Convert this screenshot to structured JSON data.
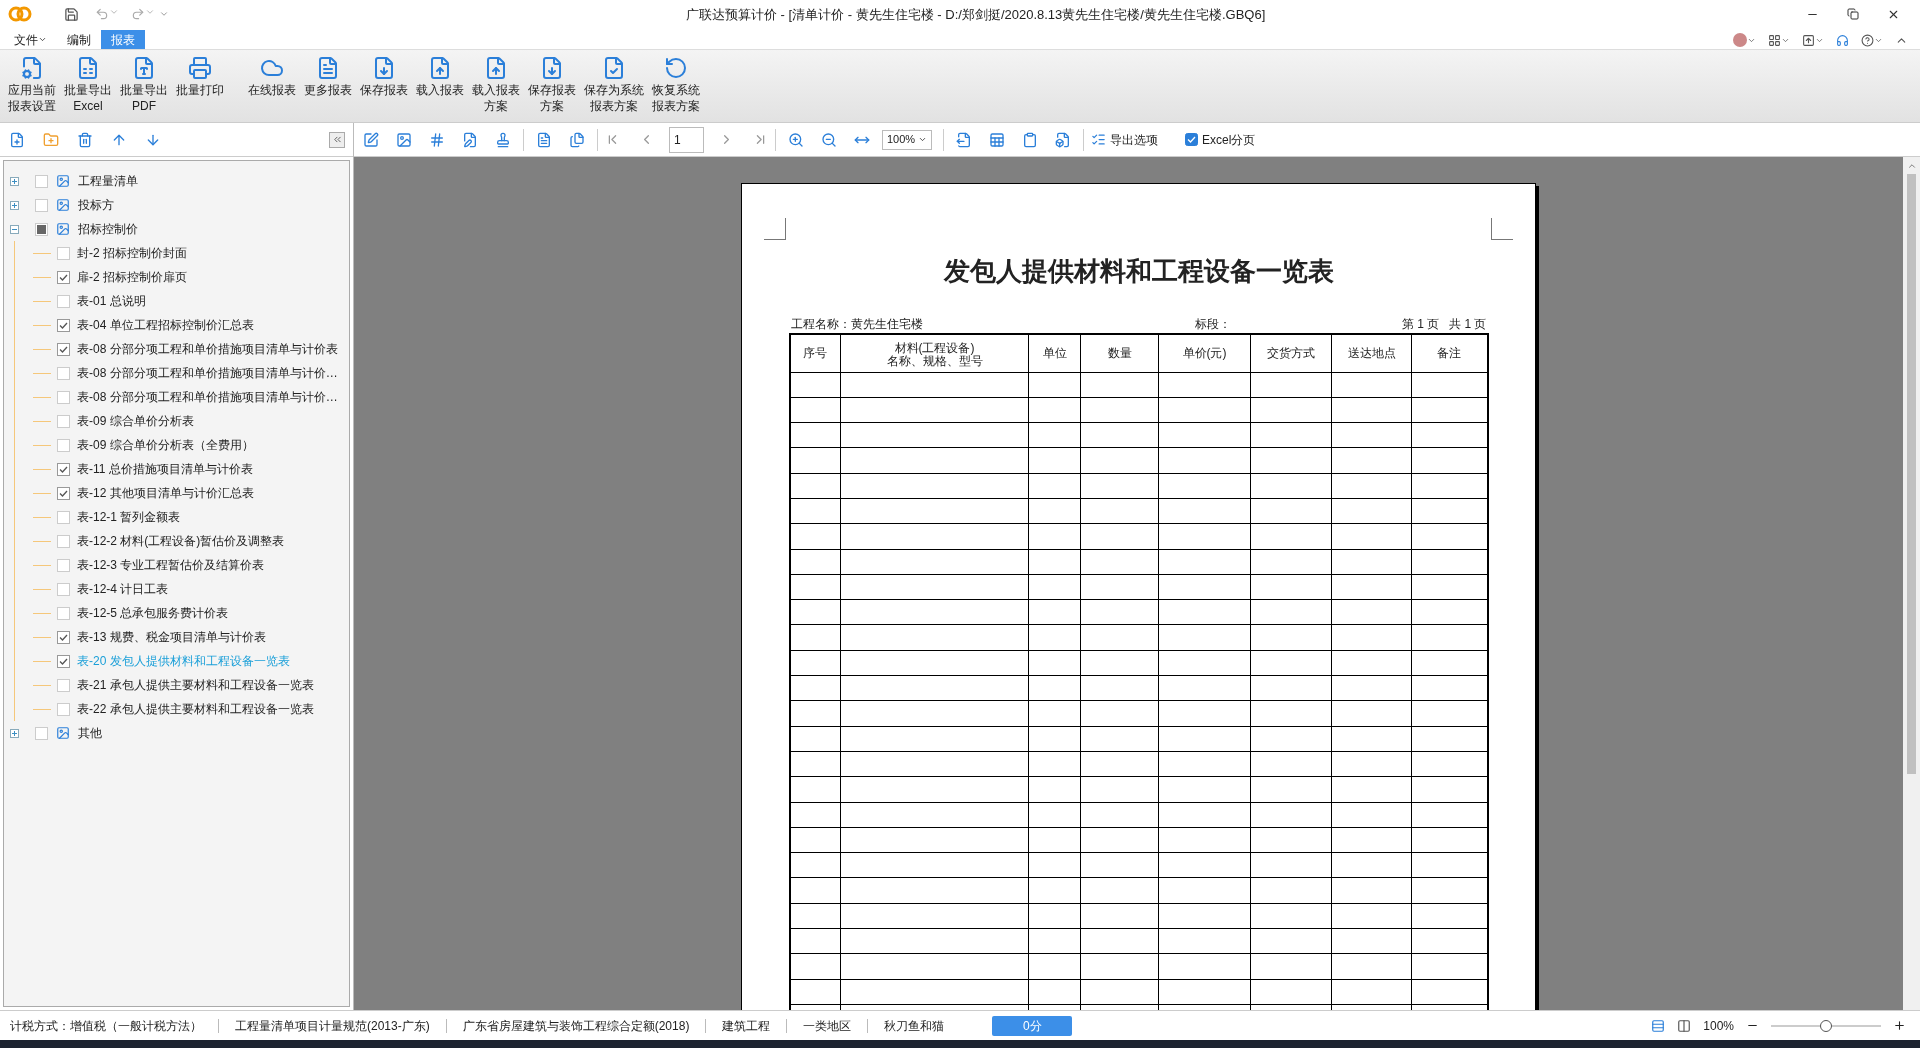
{
  "window": {
    "title": "广联达预算计价 - [清单计价 - 黄先生住宅楼 - D:/郑剑挺/2020.8.13黄先生住宅楼/黄先生住宅楼.GBQ6]"
  },
  "menu_tabs": [
    {
      "label": "文件",
      "kind": "dropdown",
      "selected": false
    },
    {
      "label": "编制",
      "kind": "tab",
      "selected": false
    },
    {
      "label": "报表",
      "kind": "tab",
      "selected": true
    }
  ],
  "ribbon": [
    {
      "lines": [
        "应用当前",
        "报表设置"
      ]
    },
    {
      "lines": [
        "批量导出",
        "Excel"
      ]
    },
    {
      "lines": [
        "批量导出",
        "PDF"
      ]
    },
    {
      "lines": [
        "批量打印"
      ]
    },
    {
      "lines": [
        "在线报表"
      ]
    },
    {
      "lines": [
        "更多报表"
      ]
    },
    {
      "lines": [
        "保存报表"
      ]
    },
    {
      "lines": [
        "载入报表"
      ]
    },
    {
      "lines": [
        "载入报表",
        "方案"
      ]
    },
    {
      "lines": [
        "保存报表",
        "方案"
      ]
    },
    {
      "lines": [
        "保存为系统",
        "报表方案"
      ]
    },
    {
      "lines": [
        "恢复系统",
        "报表方案"
      ]
    }
  ],
  "tree": [
    {
      "label": "工程量清单",
      "checked": false,
      "indeterminate": false,
      "expanded": false
    },
    {
      "label": "投标方",
      "checked": false,
      "indeterminate": false,
      "expanded": false
    },
    {
      "label": "招标控制价",
      "checked": false,
      "indeterminate": true,
      "expanded": true,
      "children": [
        {
          "label": "封-2  招标控制价封面",
          "checked": false,
          "selected": false
        },
        {
          "label": "扉-2  招标控制价扉页",
          "checked": true,
          "selected": false
        },
        {
          "label": "表-01  总说明",
          "checked": false,
          "selected": false
        },
        {
          "label": "表-04  单位工程招标控制价汇总表",
          "checked": true,
          "selected": false
        },
        {
          "label": "表-08  分部分项工程和单价措施项目清单与计价表",
          "checked": true,
          "selected": false
        },
        {
          "label": "表-08  分部分项工程和单价措施项目清单与计价…",
          "checked": false,
          "selected": false
        },
        {
          "label": "表-08  分部分项工程和单价措施项目清单与计价…",
          "checked": false,
          "selected": false
        },
        {
          "label": "表-09  综合单价分析表",
          "checked": false,
          "selected": false
        },
        {
          "label": "表-09  综合单价分析表（全费用）",
          "checked": false,
          "selected": false
        },
        {
          "label": "表-11  总价措施项目清单与计价表",
          "checked": true,
          "selected": false
        },
        {
          "label": "表-12  其他项目清单与计价汇总表",
          "checked": true,
          "selected": false
        },
        {
          "label": "表-12-1  暂列金额表",
          "checked": false,
          "selected": false
        },
        {
          "label": "表-12-2  材料(工程设备)暂估价及调整表",
          "checked": false,
          "selected": false
        },
        {
          "label": "表-12-3  专业工程暂估价及结算价表",
          "checked": false,
          "selected": false
        },
        {
          "label": "表-12-4  计日工表",
          "checked": false,
          "selected": false
        },
        {
          "label": "表-12-5  总承包服务费计价表",
          "checked": false,
          "selected": false
        },
        {
          "label": "表-13  规费、税金项目清单与计价表",
          "checked": true,
          "selected": false
        },
        {
          "label": "表-20  发包人提供材料和工程设备一览表",
          "checked": true,
          "selected": true
        },
        {
          "label": "表-21  承包人提供主要材料和工程设备一览表",
          "checked": false,
          "selected": false
        },
        {
          "label": "表-22  承包人提供主要材料和工程设备一览表",
          "checked": false,
          "selected": false
        }
      ]
    },
    {
      "label": "其他",
      "checked": false,
      "indeterminate": false,
      "expanded": false
    }
  ],
  "preview_toolbar": {
    "page_field": {
      "value": "1"
    },
    "zoom_select": {
      "value": "100%"
    },
    "export_options": "导出选项",
    "excel_paging": {
      "label": "Excel分页",
      "checked": true
    }
  },
  "document": {
    "title": "发包人提供材料和工程设备一览表",
    "project": "工程名称：黄先生住宅楼",
    "section": "标段：",
    "page_info": "第 1 页   共 1 页",
    "columns": [
      {
        "lines": [
          "序号"
        ]
      },
      {
        "lines": [
          "材料(工程设备)",
          "名称、规格、型号"
        ]
      },
      {
        "lines": [
          "单位"
        ]
      },
      {
        "lines": [
          "数量"
        ]
      },
      {
        "lines": [
          "单价(元)"
        ]
      },
      {
        "lines": [
          "交货方式"
        ]
      },
      {
        "lines": [
          "送达地点"
        ]
      },
      {
        "lines": [
          "备注"
        ]
      }
    ]
  },
  "status_bar": {
    "items": [
      "计税方式：增值税（一般计税方法）",
      "工程量清单项目计量规范(2013-广东)",
      "广东省房屋建筑与装饰工程综合定额(2018)",
      "建筑工程",
      "一类地区",
      "秋刀鱼和猫"
    ],
    "score": "0分",
    "zoom": "100%",
    "zoom_slider": {
      "level": 0.5
    }
  }
}
